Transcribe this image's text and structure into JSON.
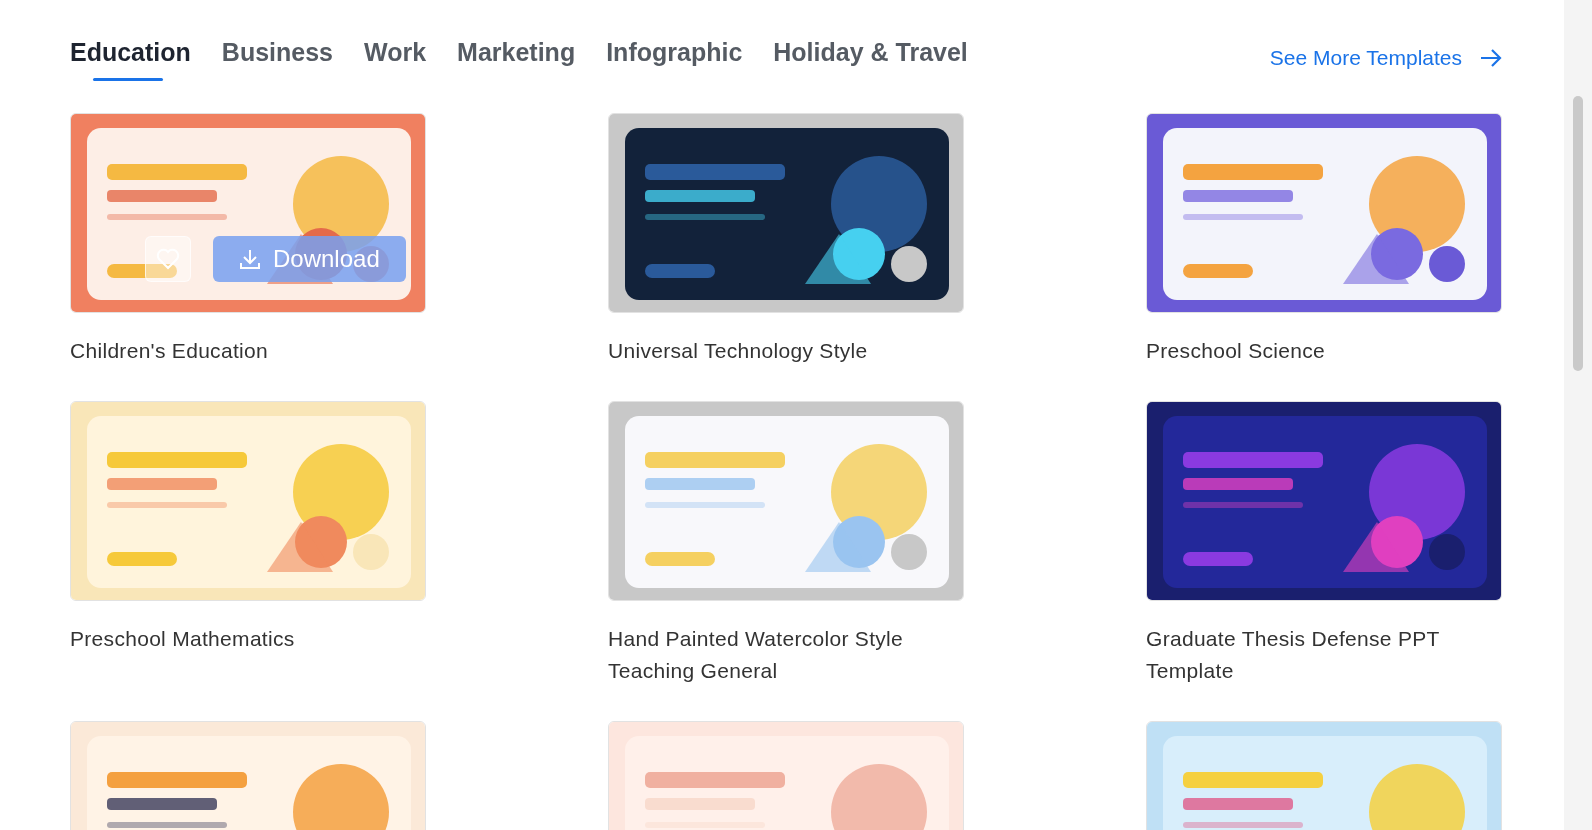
{
  "tabs": [
    {
      "label": "Education",
      "selected": true
    },
    {
      "label": "Business",
      "selected": false
    },
    {
      "label": "Work",
      "selected": false
    },
    {
      "label": "Marketing",
      "selected": false
    },
    {
      "label": "Infographic",
      "selected": false
    },
    {
      "label": "Holiday & Travel",
      "selected": false
    }
  ],
  "see_more": {
    "label": "See More Templates"
  },
  "templates": [
    {
      "title": "Children's Education",
      "hovered": true,
      "download_label": "Download"
    },
    {
      "title": "Universal Technology Style",
      "hovered": false
    },
    {
      "title": "Preschool Science",
      "hovered": false
    },
    {
      "title": "Preschool Mathematics",
      "hovered": false
    },
    {
      "title": "Hand Painted Watercolor Style Teaching General",
      "hovered": false
    },
    {
      "title": "Graduate Thesis Defense PPT Template",
      "hovered": false
    },
    {
      "hovered": false
    },
    {
      "hovered": false
    },
    {
      "hovered": false
    }
  ]
}
